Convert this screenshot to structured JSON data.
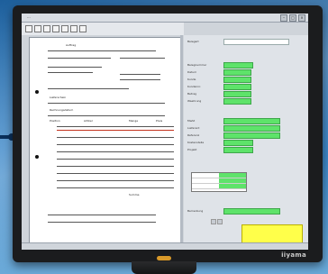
{
  "window": {
    "title": "...",
    "controls": [
      "–",
      "□",
      "×"
    ]
  },
  "document": {
    "lines": [
      "Auftrag",
      "Lieferschein",
      "Rechnungsdatum",
      "Position",
      "Artikel",
      "Menge",
      "Preis",
      "Summe"
    ]
  },
  "right_pane": {
    "fields": [
      {
        "label": "Belegart",
        "value": "",
        "green": false
      },
      {
        "label": "Belegnummer",
        "value": "",
        "green": true
      },
      {
        "label": "Datum",
        "value": "",
        "green": true
      },
      {
        "label": "Kunde",
        "value": "",
        "green": true
      },
      {
        "label": "Kundennr.",
        "value": "",
        "green": true
      },
      {
        "label": "Betrag",
        "value": "",
        "green": true
      },
      {
        "label": "Waehrung",
        "value": "",
        "green": true
      },
      {
        "label": "MwSt",
        "value": "",
        "green": true
      },
      {
        "label": "Lieferant",
        "value": "",
        "green": true
      },
      {
        "label": "Referenz",
        "value": "",
        "green": true
      },
      {
        "label": "Kostenstelle",
        "value": "",
        "green": true
      },
      {
        "label": "Projekt",
        "value": "",
        "green": true
      },
      {
        "label": "Bemerkung",
        "value": "",
        "green": true
      }
    ],
    "section_table": "",
    "section_notes": "",
    "tabs": [
      "",
      ""
    ],
    "yellow_label": ""
  },
  "status": [
    "",
    "",
    "",
    ""
  ],
  "brand": "iiyama"
}
